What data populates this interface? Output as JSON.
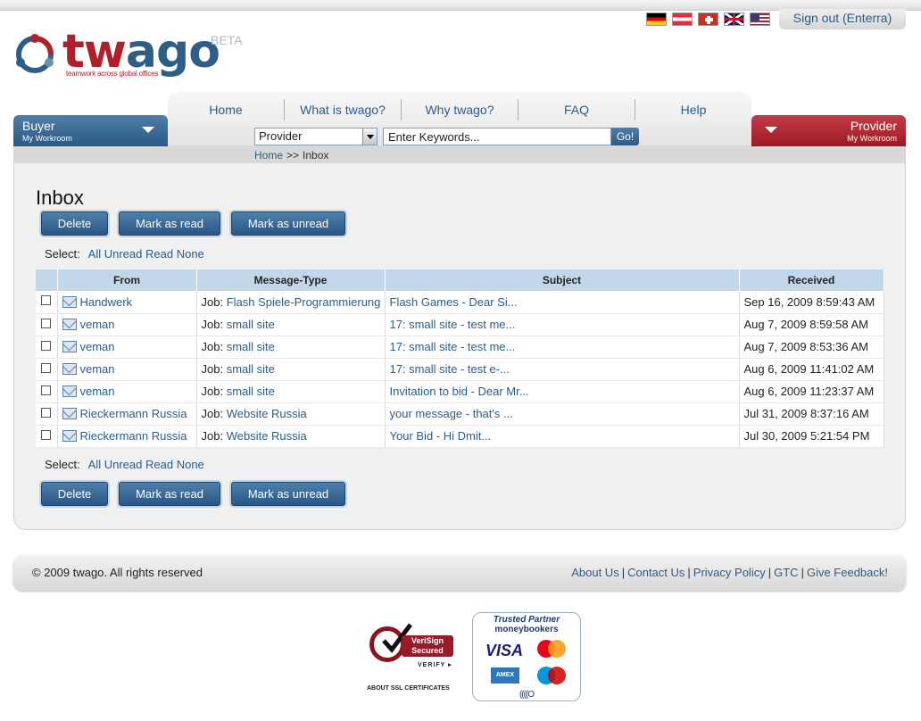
{
  "header": {
    "flags": [
      {
        "name": "de-flag-icon",
        "class": "flag-de"
      },
      {
        "name": "at-flag-icon",
        "class": "flag-at"
      },
      {
        "name": "ch-flag-icon",
        "class": "flag-ch"
      },
      {
        "name": "uk-flag-icon",
        "class": "flag-uk"
      },
      {
        "name": "us-flag-icon",
        "class": "flag-us"
      }
    ],
    "signout_label": "Sign out (Enterra)"
  },
  "logo": {
    "word_tw": "tw",
    "word_ago": "ago",
    "beta": "BETA",
    "tagline": "teamwork across global offices"
  },
  "nav": {
    "items": [
      "Home",
      "What is twago?",
      "Why twago?",
      "FAQ",
      "Help"
    ],
    "buyer": {
      "title": "Buyer",
      "subtitle": "My Workroom"
    },
    "provider": {
      "title": "Provider",
      "subtitle": "My Workroom"
    }
  },
  "search": {
    "select_value": "Provider",
    "placeholder": "Enter Keywords...",
    "go_label": "Go!"
  },
  "breadcrumb": {
    "home": "Home",
    "separator": ">>",
    "current": "Inbox"
  },
  "inbox": {
    "title": "Inbox",
    "buttons": {
      "delete": "Delete",
      "mark_read": "Mark as read",
      "mark_unread": "Mark as unread"
    },
    "select": {
      "label": "Select:",
      "all": "All",
      "unread": "Unread",
      "read": "Read",
      "none": "None"
    },
    "columns": [
      "From",
      "Message-Type",
      "Subject",
      "Received"
    ],
    "rows": [
      {
        "from": "Handwerk",
        "job_prefix": "Job:",
        "job": "Flash Spiele-Programmierung",
        "subject": "Flash Games -  Dear Si...",
        "received": "Sep 16, 2009 8:59:43 AM"
      },
      {
        "from": "veman",
        "job_prefix": "Job:",
        "job": "small site",
        "subject": "17: small site -  test me...",
        "received": "Aug 7, 2009 8:59:58 AM"
      },
      {
        "from": "veman",
        "job_prefix": "Job:",
        "job": "small site",
        "subject": "17: small site -  test me...",
        "received": "Aug 7, 2009 8:53:36 AM"
      },
      {
        "from": "veman",
        "job_prefix": "Job:",
        "job": "small site",
        "subject": "17: small site -  test e-...",
        "received": "Aug 6, 2009 11:41:02 AM"
      },
      {
        "from": "veman",
        "job_prefix": "Job:",
        "job": "small site",
        "subject": "Invitation to bid -  Dear Mr...",
        "received": "Aug 6, 2009 11:23:37 AM"
      },
      {
        "from": "Rieckermann Russia",
        "job_prefix": "Job:",
        "job": "Website Russia",
        "subject": "your message -  that's ...",
        "received": "Jul 31, 2009 8:37:16 AM"
      },
      {
        "from": "Rieckermann Russia",
        "job_prefix": "Job:",
        "job": "Website Russia",
        "subject": "Your Bid -  Hi Dmit...",
        "received": "Jul 30, 2009 5:21:54 PM"
      }
    ]
  },
  "footer": {
    "copyright": "© 2009 twago. All rights reserved",
    "links": [
      "About Us",
      "Contact Us",
      "Privacy Policy",
      "GTC",
      "Give Feedback!"
    ]
  },
  "badges": {
    "verisign": {
      "label": "VeriSign Secured",
      "verify": "VERIFY ▸",
      "about": "ABOUT SSL CERTIFICATES"
    },
    "trusted": {
      "title": "Trusted Partner",
      "brand": "moneybookers",
      "visa": "VISA",
      "amex": "AMEX",
      "bottom": "((((O"
    }
  }
}
